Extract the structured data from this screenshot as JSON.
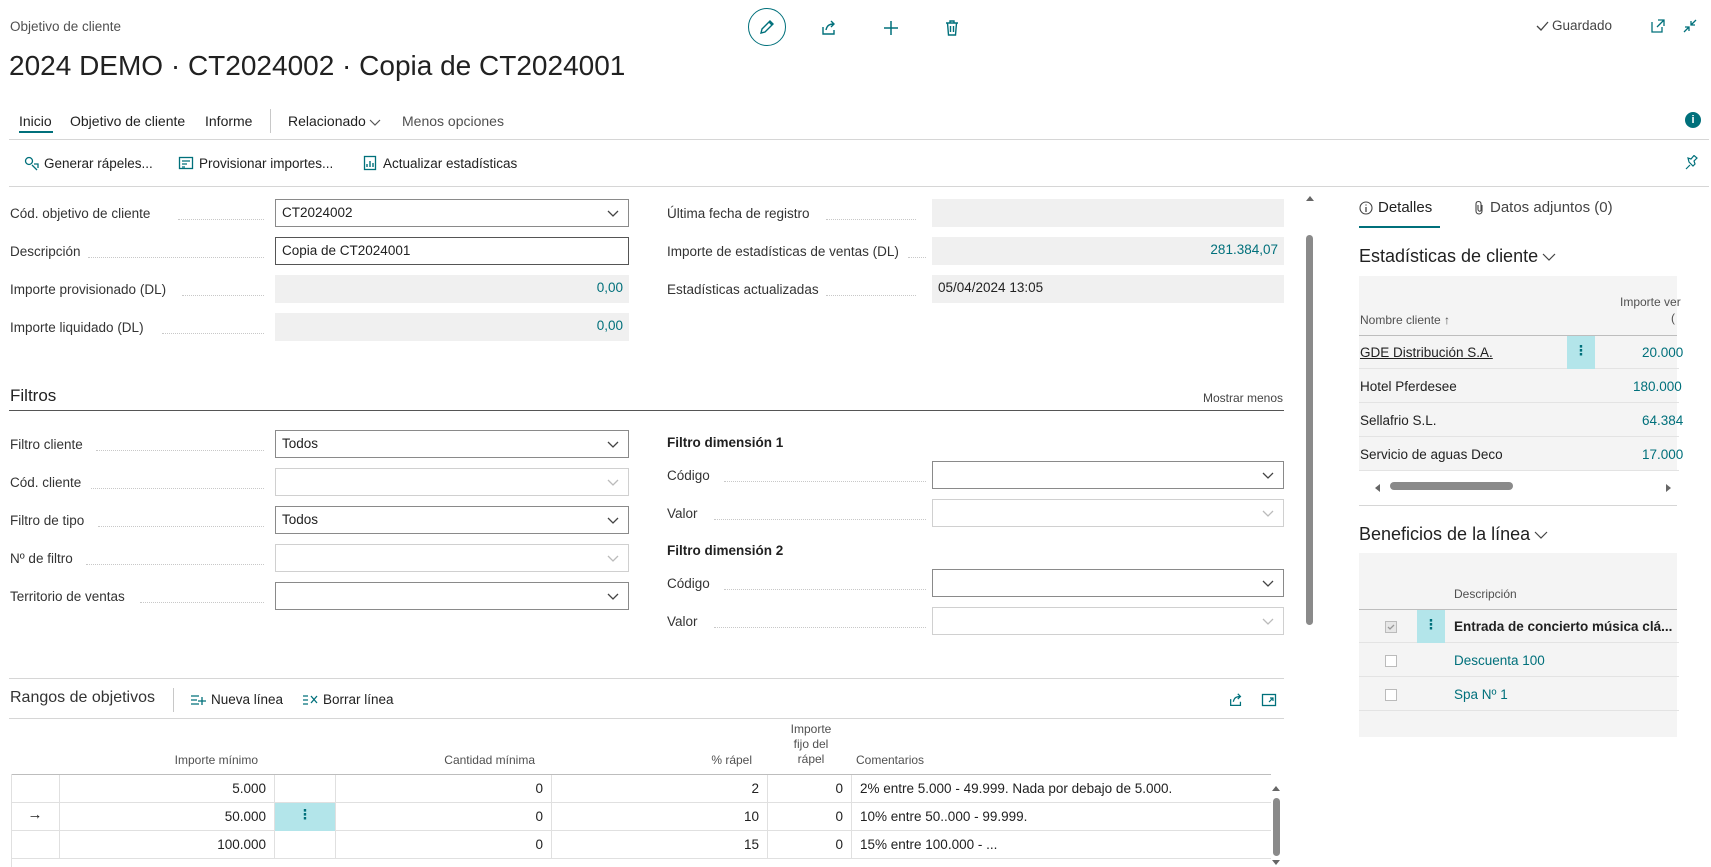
{
  "header": {
    "breadcrumb": "Objetivo de cliente",
    "title": "2024 DEMO · CT2024002 · Copia de CT2024001",
    "saved_status": "Guardado"
  },
  "tabs": [
    {
      "label": "Inicio",
      "active": true
    },
    {
      "label": "Objetivo de cliente"
    },
    {
      "label": "Informe"
    },
    {
      "label": "Relacionado"
    },
    {
      "label": "Menos opciones"
    }
  ],
  "actions": [
    {
      "label": "Generar rápeles..."
    },
    {
      "label": "Provisionar importes..."
    },
    {
      "label": "Actualizar estadísticas"
    }
  ],
  "general": {
    "cod_objetivo_label": "Cód. objetivo de cliente",
    "cod_objetivo_value": "CT2024002",
    "descripcion_label": "Descripción",
    "descripcion_value": "Copia de CT2024001",
    "importe_prov_label": "Importe provisionado (DL)",
    "importe_prov_value": "0,00",
    "importe_liq_label": "Importe liquidado (DL)",
    "importe_liq_value": "0,00",
    "ultima_fecha_label": "Última fecha de registro",
    "ultima_fecha_value": "",
    "importe_est_label": "Importe de estadísticas de ventas (DL)",
    "importe_est_value": "281.384,07",
    "est_act_label": "Estadísticas actualizadas",
    "est_act_value": "05/04/2024 13:05"
  },
  "filtros": {
    "title": "Filtros",
    "show_less": "Mostrar menos",
    "filtro_cliente_label": "Filtro cliente",
    "filtro_cliente_value": "Todos",
    "cod_cliente_label": "Cód. cliente",
    "filtro_tipo_label": "Filtro de tipo",
    "filtro_tipo_value": "Todos",
    "n_filtro_label": "Nº de filtro",
    "territorio_label": "Territorio de ventas",
    "dim1_title": "Filtro dimensión 1",
    "dim2_title": "Filtro dimensión 2",
    "codigo_label": "Código",
    "valor_label": "Valor"
  },
  "rangos": {
    "title": "Rangos de objetivos",
    "nueva_linea": "Nueva línea",
    "borrar_linea": "Borrar línea",
    "headers": {
      "importe_minimo": "Importe mínimo",
      "cantidad_minima": "Cantidad mínima",
      "pct_rapel": "% rápel",
      "importe_fijo_1": "Importe",
      "importe_fijo_2": "fijo del",
      "importe_fijo_3": "rápel",
      "comentarios": "Comentarios"
    },
    "rows": [
      {
        "importe": "5.000",
        "cantidad": "0",
        "pct": "2",
        "fijo": "0",
        "comentario": "2% entre 5.000 - 49.999. Nada por debajo de 5.000."
      },
      {
        "importe": "50.000",
        "cantidad": "0",
        "pct": "10",
        "fijo": "0",
        "comentario": "10% entre 50..000 - 99.999."
      },
      {
        "importe": "100.000",
        "cantidad": "0",
        "pct": "15",
        "fijo": "0",
        "comentario": "15% entre 100.000 - ..."
      }
    ]
  },
  "factbox": {
    "tab_detalles": "Detalles",
    "tab_adjuntos": "Datos adjuntos (0)",
    "est_title": "Estadísticas de cliente",
    "col_nombre": "Nombre cliente ↑",
    "col_importe": "Importe ver",
    "col_importe_2": "(",
    "clientes": [
      {
        "nombre": "GDE Distribución S.A.",
        "importe": "20.000"
      },
      {
        "nombre": "Hotel Pferdesee",
        "importe": "180.000"
      },
      {
        "nombre": "Sellafrio S.L.",
        "importe": "64.384"
      },
      {
        "nombre": "Servicio de aguas Deco",
        "importe": "17.000"
      }
    ],
    "beneficios_title": "Beneficios de la línea",
    "col_descripcion": "Descripción",
    "beneficios": [
      {
        "descripcion": "Entrada de concierto música clá...",
        "checked": true
      },
      {
        "descripcion": "Descuenta 100",
        "checked": false
      },
      {
        "descripcion": "Spa Nº 1",
        "checked": false
      }
    ]
  },
  "colors": {
    "accent": "#00707b",
    "selected": "#b3e5ea"
  }
}
